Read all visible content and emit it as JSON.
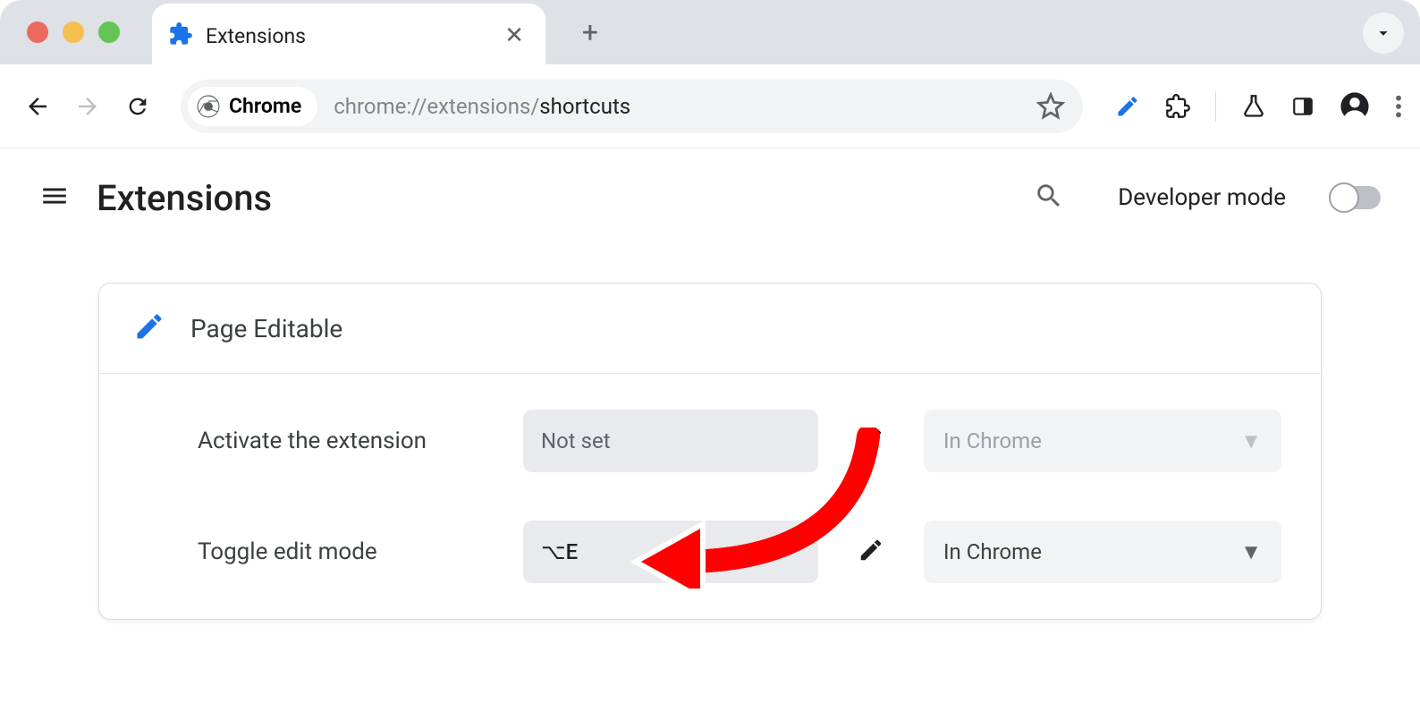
{
  "window": {
    "tab_title": "Extensions",
    "chrome_badge": "Chrome",
    "url_prefix": "chrome://extensions/",
    "url_path": "shortcuts"
  },
  "header": {
    "title": "Extensions",
    "dev_mode_label": "Developer mode"
  },
  "card": {
    "extension_name": "Page Editable",
    "rows": [
      {
        "label": "Activate the extension",
        "shortcut": "Not set",
        "scope": "In Chrome",
        "disabled": true
      },
      {
        "label": "Toggle edit mode",
        "shortcut": "⌥E",
        "scope": "In Chrome",
        "disabled": false
      }
    ]
  }
}
